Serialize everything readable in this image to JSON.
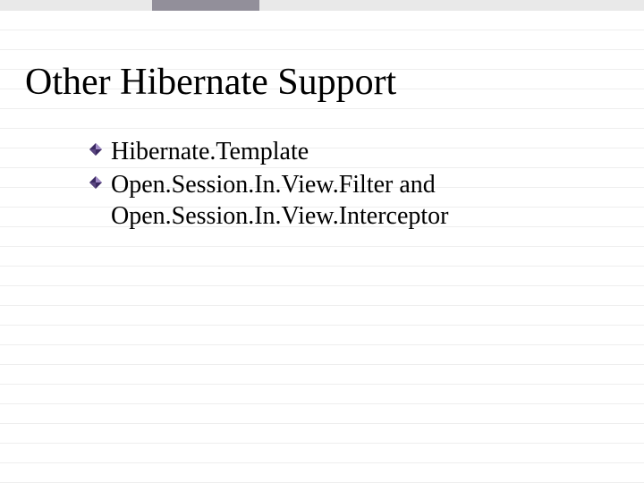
{
  "colors": {
    "bullet_dark": "#3c2a63",
    "bullet_light": "#a18cc7"
  },
  "title": "Other Hibernate Support",
  "bullets": [
    {
      "text": "Hibernate.Template"
    },
    {
      "text": "Open.Session.In.View.Filter and Open.Session.In.View.Interceptor"
    }
  ]
}
